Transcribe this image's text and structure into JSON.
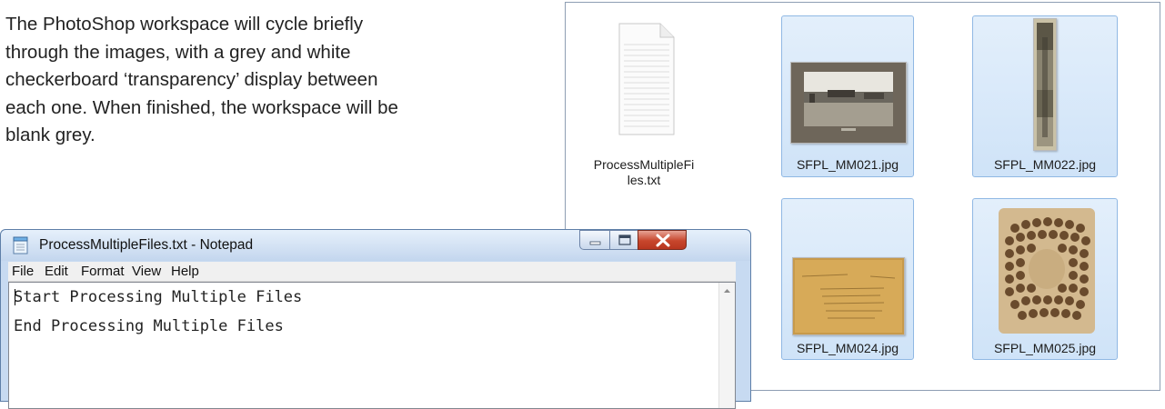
{
  "document": {
    "lines": [
      "The PhotoShop workspace will cycle briefly",
      "through the images, with a grey and white",
      "checkerboard ‘transparency’ display between",
      "each one.  When finished, the workspace will be",
      "blank grey."
    ]
  },
  "explorer": {
    "files": [
      {
        "name_line1": "ProcessMultipleFi",
        "name_line2": "les.txt",
        "icon": "text-file-icon"
      },
      {
        "name": "SFPL_MM021.jpg",
        "icon": "photo-thumbnail"
      },
      {
        "name": "SFPL_MM022.jpg",
        "icon": "photo-thumbnail"
      },
      {
        "name": "SFPL_MM024.jpg",
        "icon": "photo-thumbnail"
      },
      {
        "name": "SFPL_MM025.jpg",
        "icon": "photo-thumbnail"
      }
    ]
  },
  "notepad": {
    "title": "ProcessMultipleFiles.txt - Notepad",
    "menu": [
      "File",
      "Edit",
      "Format",
      "View",
      "Help"
    ],
    "content_lines": [
      "Start Processing Multiple Files",
      "End Processing Multiple Files"
    ],
    "title_bar_close_color": "#c7462c"
  }
}
